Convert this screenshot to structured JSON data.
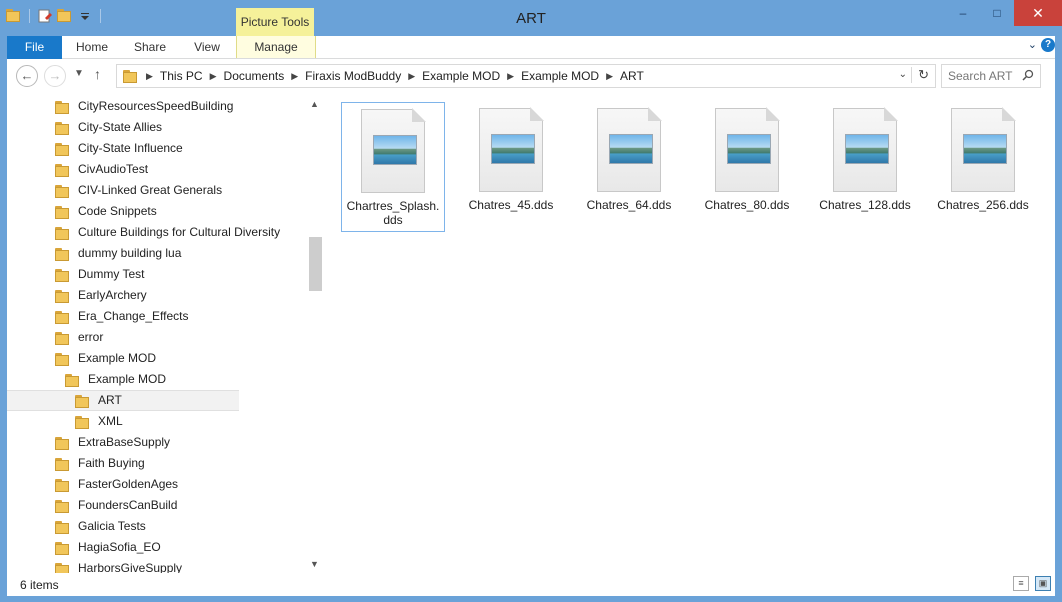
{
  "window": {
    "title": "ART",
    "contextual_tab_group": "Picture Tools",
    "buttons": {
      "minimize": "–",
      "maximize": "□",
      "close": "✕"
    }
  },
  "ribbon": {
    "tabs": [
      "File",
      "Home",
      "Share",
      "View",
      "Manage"
    ],
    "file_tab_color": "#1979ca"
  },
  "address": {
    "crumbs": [
      "This PC",
      "Documents",
      "Firaxis ModBuddy",
      "Example MOD",
      "Example MOD",
      "ART"
    ],
    "search_placeholder": "Search ART"
  },
  "nav_tree": {
    "items": [
      {
        "label": "CityResourcesSpeedBuilding",
        "level": 0
      },
      {
        "label": "City-State Allies",
        "level": 0
      },
      {
        "label": "City-State Influence",
        "level": 0
      },
      {
        "label": "CivAudioTest",
        "level": 0
      },
      {
        "label": "CIV-Linked Great Generals",
        "level": 0
      },
      {
        "label": "Code Snippets",
        "level": 0
      },
      {
        "label": "Culture Buildings for Cultural Diversity",
        "level": 0
      },
      {
        "label": "dummy building lua",
        "level": 0
      },
      {
        "label": "Dummy Test",
        "level": 0
      },
      {
        "label": "EarlyArchery",
        "level": 0
      },
      {
        "label": "Era_Change_Effects",
        "level": 0
      },
      {
        "label": "error",
        "level": 0
      },
      {
        "label": "Example MOD",
        "level": 0
      },
      {
        "label": "Example MOD",
        "level": 1
      },
      {
        "label": "ART",
        "level": 2,
        "selected": true
      },
      {
        "label": "XML",
        "level": 2
      },
      {
        "label": "ExtraBaseSupply",
        "level": 0
      },
      {
        "label": "Faith Buying",
        "level": 0
      },
      {
        "label": "FasterGoldenAges",
        "level": 0
      },
      {
        "label": "FoundersCanBuild",
        "level": 0
      },
      {
        "label": "Galicia Tests",
        "level": 0
      },
      {
        "label": "HagiaSofia_EO",
        "level": 0
      },
      {
        "label": "HarborsGiveSupply",
        "level": 0
      }
    ]
  },
  "files": [
    {
      "name": "Chartres_Splash.dds",
      "selected": true
    },
    {
      "name": "Chatres_45.dds"
    },
    {
      "name": "Chatres_64.dds"
    },
    {
      "name": "Chatres_80.dds"
    },
    {
      "name": "Chatres_128.dds"
    },
    {
      "name": "Chatres_256.dds"
    }
  ],
  "status": {
    "item_count": "6 items"
  }
}
